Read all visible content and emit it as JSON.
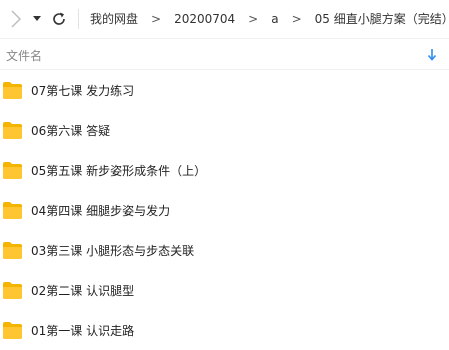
{
  "breadcrumb": [
    "我的网盘",
    "20200704",
    "a",
    "05 细直小腿方案（完结）"
  ],
  "breadcrumb_separator": ">",
  "header": {
    "name_label": "文件名"
  },
  "files": [
    {
      "name": "07第七课 发力练习"
    },
    {
      "name": "06第六课 答疑"
    },
    {
      "name": "05第五课 新步姿形成条件（上）"
    },
    {
      "name": "04第四课 细腿步姿与发力"
    },
    {
      "name": "03第三课 小腿形态与步态关联"
    },
    {
      "name": "02第二课 认识腿型"
    },
    {
      "name": "01第一课 认识走路"
    }
  ],
  "colors": {
    "folder": "#FFC532",
    "folder_tab": "#F5B400",
    "accent": "#2D8CF0"
  }
}
